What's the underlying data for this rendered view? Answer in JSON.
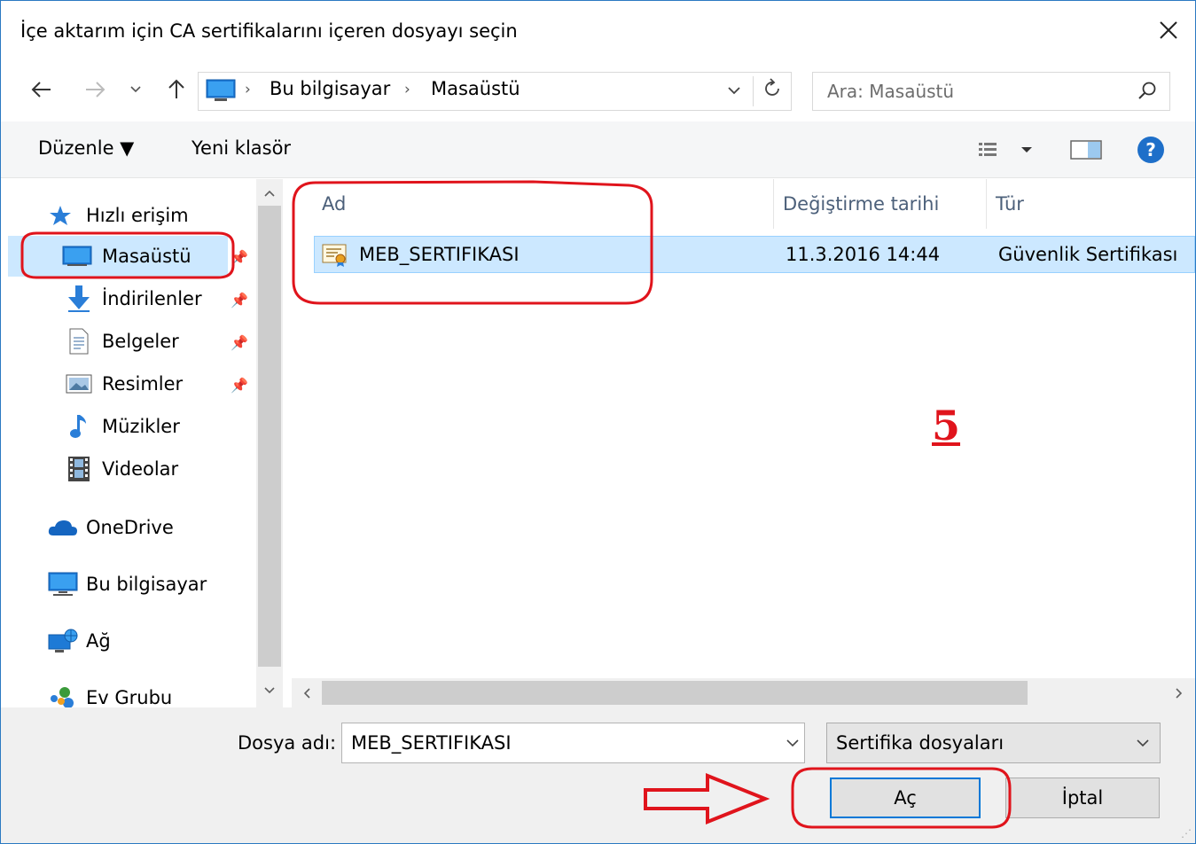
{
  "window": {
    "title": "İçe aktarım için CA sertifikalarını içeren dosyayı seçin",
    "close_icon": "close-icon"
  },
  "address": {
    "crumbs": [
      "Bu bilgisayar",
      "Masaüstü"
    ],
    "search_placeholder": "Ara: Masaüstü"
  },
  "toolbar": {
    "organize_label": "Düzenle ▼",
    "new_folder_label": "Yeni klasör"
  },
  "sidebar": {
    "items": [
      {
        "label": "Hızlı erişim",
        "icon": "star-icon"
      },
      {
        "label": "Masaüstü",
        "icon": "desktop-icon",
        "selected": true,
        "pinned": true
      },
      {
        "label": "İndirilenler",
        "icon": "download-icon",
        "pinned": true
      },
      {
        "label": "Belgeler",
        "icon": "documents-icon",
        "pinned": true
      },
      {
        "label": "Resimler",
        "icon": "pictures-icon",
        "pinned": true
      },
      {
        "label": "Müzikler",
        "icon": "music-icon"
      },
      {
        "label": "Videolar",
        "icon": "video-icon"
      },
      {
        "label": "OneDrive",
        "icon": "cloud-icon"
      },
      {
        "label": "Bu bilgisayar",
        "icon": "computer-icon"
      },
      {
        "label": "Ağ",
        "icon": "network-icon"
      },
      {
        "label": "Ev Grubu",
        "icon": "homegroup-icon"
      }
    ]
  },
  "filelist": {
    "columns": [
      "Ad",
      "Değiştirme tarihi",
      "Tür"
    ],
    "rows": [
      {
        "name": "MEB_SERTIFIKASI",
        "date": "11.3.2016 14:44",
        "type": "Güvenlik Sertifikası",
        "icon": "certificate-icon",
        "selected": true
      }
    ]
  },
  "bottom": {
    "filename_label": "Dosya adı:",
    "filename_value": "MEB_SERTIFIKASI",
    "filetype_value": "Sertifika dosyaları",
    "open_label": "Aç",
    "cancel_label": "İptal"
  },
  "annotations": {
    "step_number": "5",
    "color": "#e0141c"
  }
}
